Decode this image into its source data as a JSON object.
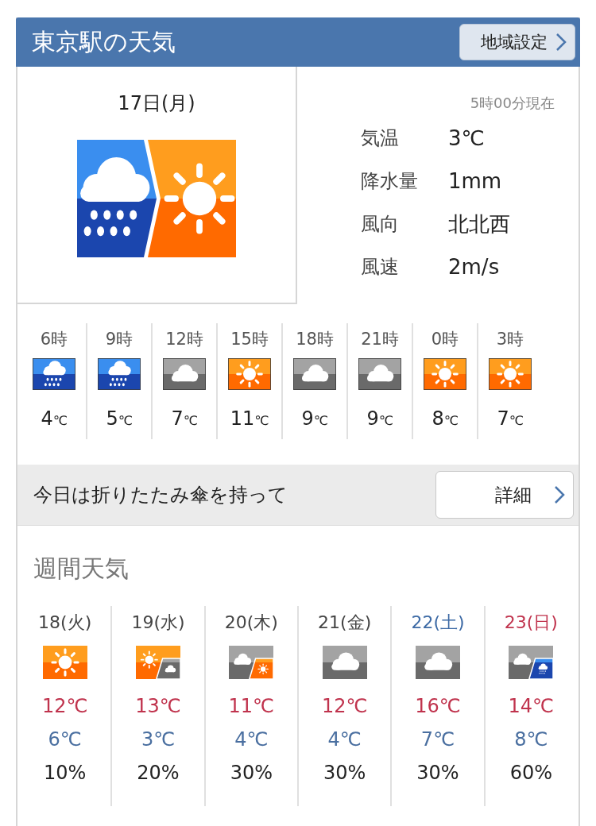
{
  "header": {
    "title": "東京駅の天気",
    "region_button": "地域設定"
  },
  "today": {
    "date": "17日(月)",
    "icon": {
      "kind": "later",
      "parts": [
        {
          "kind": "rain"
        },
        {
          "kind": "sunny"
        }
      ]
    },
    "observed": "5時00分現在",
    "stats": [
      {
        "label": "気温",
        "value": "3℃"
      },
      {
        "label": "降水量",
        "value": "1mm"
      },
      {
        "label": "風向",
        "value": "北北西"
      },
      {
        "label": "風速",
        "value": "2m/s"
      }
    ]
  },
  "hourly": [
    {
      "time": "6時",
      "icon": {
        "kind": "single",
        "parts": [
          {
            "kind": "rain"
          }
        ]
      },
      "temp": "4",
      "unit": "℃"
    },
    {
      "time": "9時",
      "icon": {
        "kind": "single",
        "parts": [
          {
            "kind": "rain"
          }
        ]
      },
      "temp": "5",
      "unit": "℃"
    },
    {
      "time": "12時",
      "icon": {
        "kind": "single",
        "parts": [
          {
            "kind": "cloudy"
          }
        ]
      },
      "temp": "7",
      "unit": "℃"
    },
    {
      "time": "15時",
      "icon": {
        "kind": "single",
        "parts": [
          {
            "kind": "sunny"
          }
        ]
      },
      "temp": "11",
      "unit": "℃"
    },
    {
      "time": "18時",
      "icon": {
        "kind": "single",
        "parts": [
          {
            "kind": "cloudy"
          }
        ]
      },
      "temp": "9",
      "unit": "℃"
    },
    {
      "time": "21時",
      "icon": {
        "kind": "single",
        "parts": [
          {
            "kind": "cloudy"
          }
        ]
      },
      "temp": "9",
      "unit": "℃"
    },
    {
      "time": "0時",
      "icon": {
        "kind": "single",
        "parts": [
          {
            "kind": "sunny"
          }
        ]
      },
      "temp": "8",
      "unit": "℃"
    },
    {
      "time": "3時",
      "icon": {
        "kind": "single",
        "parts": [
          {
            "kind": "sunny"
          }
        ]
      },
      "temp": "7",
      "unit": "℃"
    }
  ],
  "advice": {
    "text": "今日は折りたたみ傘を持って",
    "button": "詳細"
  },
  "weekly": {
    "title": "週間天気",
    "days": [
      {
        "date": "18(火)",
        "color": "#444444",
        "icon": {
          "kind": "single",
          "parts": [
            {
              "kind": "sunny"
            }
          ]
        },
        "high": "12℃",
        "low": "6℃",
        "rain_chance": "10%"
      },
      {
        "date": "19(水)",
        "color": "#444444",
        "icon": {
          "kind": "occasional",
          "parts": [
            {
              "kind": "sunny"
            },
            {
              "kind": "cloudy"
            }
          ]
        },
        "high": "13℃",
        "low": "3℃",
        "rain_chance": "20%"
      },
      {
        "date": "20(木)",
        "color": "#444444",
        "icon": {
          "kind": "occasional",
          "parts": [
            {
              "kind": "cloudy"
            },
            {
              "kind": "sunny"
            }
          ]
        },
        "high": "11℃",
        "low": "4℃",
        "rain_chance": "30%"
      },
      {
        "date": "21(金)",
        "color": "#444444",
        "icon": {
          "kind": "single",
          "parts": [
            {
              "kind": "cloudy"
            }
          ]
        },
        "high": "12℃",
        "low": "4℃",
        "rain_chance": "30%"
      },
      {
        "date": "22(土)",
        "color": "#3d6aa5",
        "icon": {
          "kind": "single",
          "parts": [
            {
              "kind": "cloudy"
            }
          ]
        },
        "high": "16℃",
        "low": "7℃",
        "rain_chance": "30%"
      },
      {
        "date": "23(日)",
        "color": "#c0334d",
        "icon": {
          "kind": "occasional",
          "parts": [
            {
              "kind": "cloudy"
            },
            {
              "kind": "rain"
            }
          ]
        },
        "high": "14℃",
        "low": "8℃",
        "rain_chance": "60%"
      }
    ]
  }
}
